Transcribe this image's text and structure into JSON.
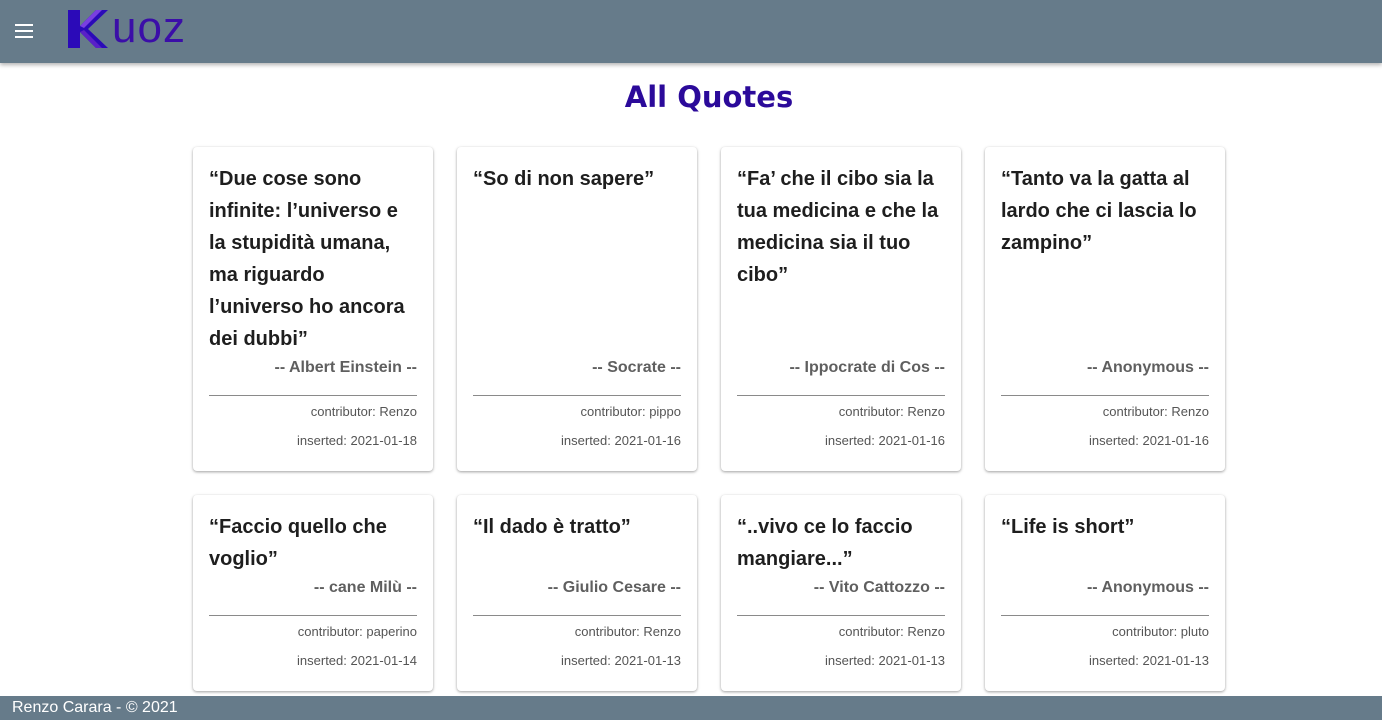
{
  "app": {
    "logo_text": "uoz",
    "logo_letter": "K"
  },
  "header": {
    "menu_icon": "menu-icon"
  },
  "main": {
    "title": "All Quotes"
  },
  "quotes": [
    {
      "text": "“Due cose sono infinite: l’universo e la stupidità umana, ma riguardo l’universo ho ancora dei dubbi”",
      "author": "-- Albert Einstein --",
      "contributor": "contributor: Renzo",
      "inserted": "inserted: 2021-01-18"
    },
    {
      "text": "“So di non sapere”",
      "author": "-- Socrate --",
      "contributor": "contributor: pippo",
      "inserted": "inserted: 2021-01-16"
    },
    {
      "text": "“Fa’ che il cibo sia la tua medicina e che la medicina sia il tuo cibo”",
      "author": "-- Ippocrate di Cos --",
      "contributor": "contributor: Renzo",
      "inserted": "inserted: 2021-01-16"
    },
    {
      "text": "“Tanto va la gatta al lardo che ci lascia lo zampino”",
      "author": "-- Anonymous --",
      "contributor": "contributor: Renzo",
      "inserted": "inserted: 2021-01-16"
    },
    {
      "text": "“Faccio quello che voglio”",
      "author": "-- cane Milù --",
      "contributor": "contributor: paperino",
      "inserted": "inserted: 2021-01-14"
    },
    {
      "text": "“Il dado è tratto”",
      "author": "-- Giulio Cesare --",
      "contributor": "contributor: Renzo",
      "inserted": "inserted: 2021-01-13"
    },
    {
      "text": "“..vivo ce lo faccio mangiare...”",
      "author": "-- Vito Cattozzo --",
      "contributor": "contributor: Renzo",
      "inserted": "inserted: 2021-01-13"
    },
    {
      "text": "“Life is short”",
      "author": "-- Anonymous --",
      "contributor": "contributor: pluto",
      "inserted": "inserted: 2021-01-13"
    }
  ],
  "footer": {
    "text": "Renzo Carara - © 2021"
  },
  "colors": {
    "topbar": "#667b8a",
    "title": "#2b0a9a",
    "logo": "#3b0ea8"
  }
}
